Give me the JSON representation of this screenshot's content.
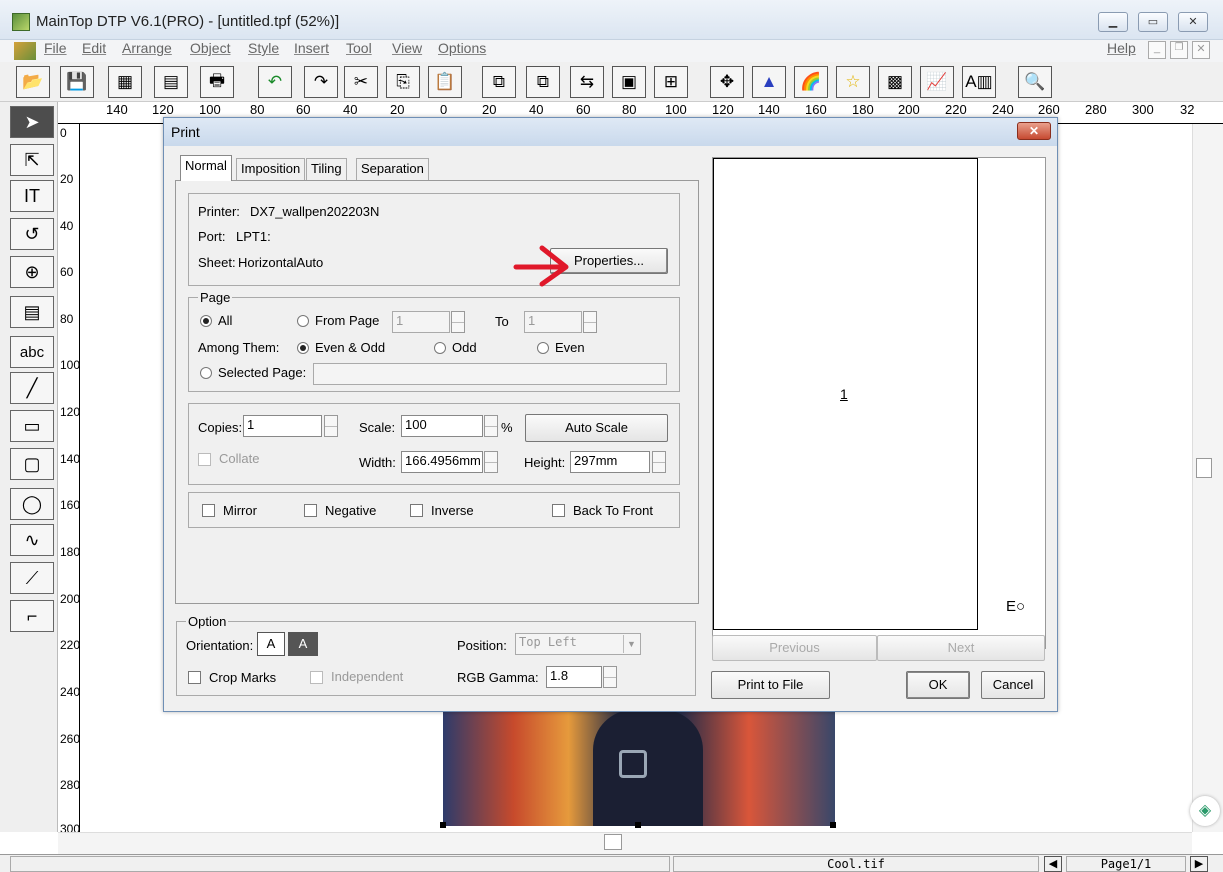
{
  "window": {
    "title": "MainTop DTP V6.1(PRO) - [untitled.tpf (52%)]"
  },
  "menu": {
    "items": [
      "File",
      "Edit",
      "Arrange",
      "Object",
      "Style",
      "Insert",
      "Tool",
      "View",
      "Options"
    ],
    "help": "Help"
  },
  "ruler": {
    "h": [
      "140",
      "120",
      "100",
      "80",
      "60",
      "40",
      "20",
      "0",
      "20",
      "40",
      "60",
      "80",
      "100",
      "120",
      "140",
      "160",
      "180",
      "200",
      "220",
      "240",
      "260",
      "280",
      "300",
      "32"
    ],
    "v": [
      "0",
      "20",
      "40",
      "60",
      "80",
      "100",
      "120",
      "140",
      "160",
      "180",
      "200",
      "220",
      "240",
      "260",
      "280",
      "300"
    ]
  },
  "dialog": {
    "title": "Print",
    "close": "✕",
    "tabs": [
      "Normal",
      "Imposition",
      "Tiling",
      "Separation"
    ],
    "printer_label": "Printer:",
    "printer_value": "DX7_wallpen202203N",
    "port_label": "Port:",
    "port_value": "LPT1:",
    "sheet_label": "Sheet:",
    "sheet_value": "HorizontalAuto",
    "properties_button": "Properties...",
    "page": {
      "group": "Page",
      "all": "All",
      "from_page": "From Page",
      "from_value": "1",
      "to": "To",
      "to_value": "1",
      "among_them": "Among Them:",
      "even_odd": "Even & Odd",
      "odd": "Odd",
      "even": "Even",
      "selected_page": "Selected Page:"
    },
    "copies_label": "Copies:",
    "copies_value": "1",
    "collate": "Collate",
    "scale_label": "Scale:",
    "scale_value": "100",
    "percent": "%",
    "auto_scale": "Auto Scale",
    "width_label": "Width:",
    "width_value": "166.4956mm",
    "height_label": "Height:",
    "height_value": "297mm",
    "mirror": "Mirror",
    "negative": "Negative",
    "inverse": "Inverse",
    "back_to_front": "Back To Front",
    "option": {
      "group": "Option",
      "orientation": "Orientation:",
      "crop_marks": "Crop Marks",
      "independent": "Independent",
      "position": "Position:",
      "position_value": "Top Left",
      "rgb_gamma": "RGB Gamma:",
      "gamma_value": "1.8"
    },
    "preview_page_number": "1",
    "previous": "Previous",
    "next": "Next",
    "print_to_file": "Print to File",
    "ok": "OK",
    "cancel": "Cancel"
  },
  "status": {
    "file": "Cool.tif",
    "page": "Page1/1"
  },
  "colors": {
    "annotation_arrow": "#e0182a"
  }
}
